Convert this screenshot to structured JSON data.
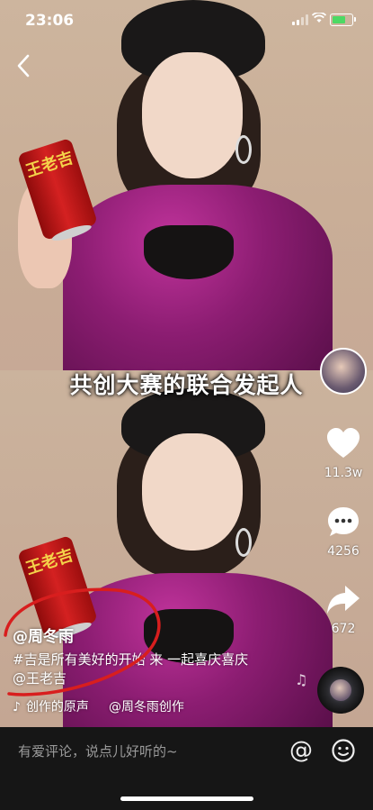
{
  "status": {
    "time": "23:06"
  },
  "video": {
    "subtitle": "共创大赛的联合发起人",
    "can_text": "王老吉"
  },
  "actions": {
    "like_count": "11.3w",
    "comment_count": "4256",
    "share_count": "672"
  },
  "post": {
    "author": "@周冬雨",
    "description": "#吉是所有美好的开始 来 一起喜庆喜庆",
    "mention": "@王老吉",
    "music_title": "创作的原声",
    "music_author": "@周冬雨创作"
  },
  "comment_bar": {
    "placeholder": "有爱评论，说点儿好听的~",
    "at_symbol": "@"
  },
  "colors": {
    "accent_mark": "#d81e1e",
    "bar_bg": "#161616",
    "battery": "#4cd964"
  },
  "icons": [
    "back-icon",
    "heart-icon",
    "comment-icon",
    "share-icon",
    "music-disc-icon",
    "tiktok-note-icon",
    "at-icon",
    "emoji-icon"
  ]
}
